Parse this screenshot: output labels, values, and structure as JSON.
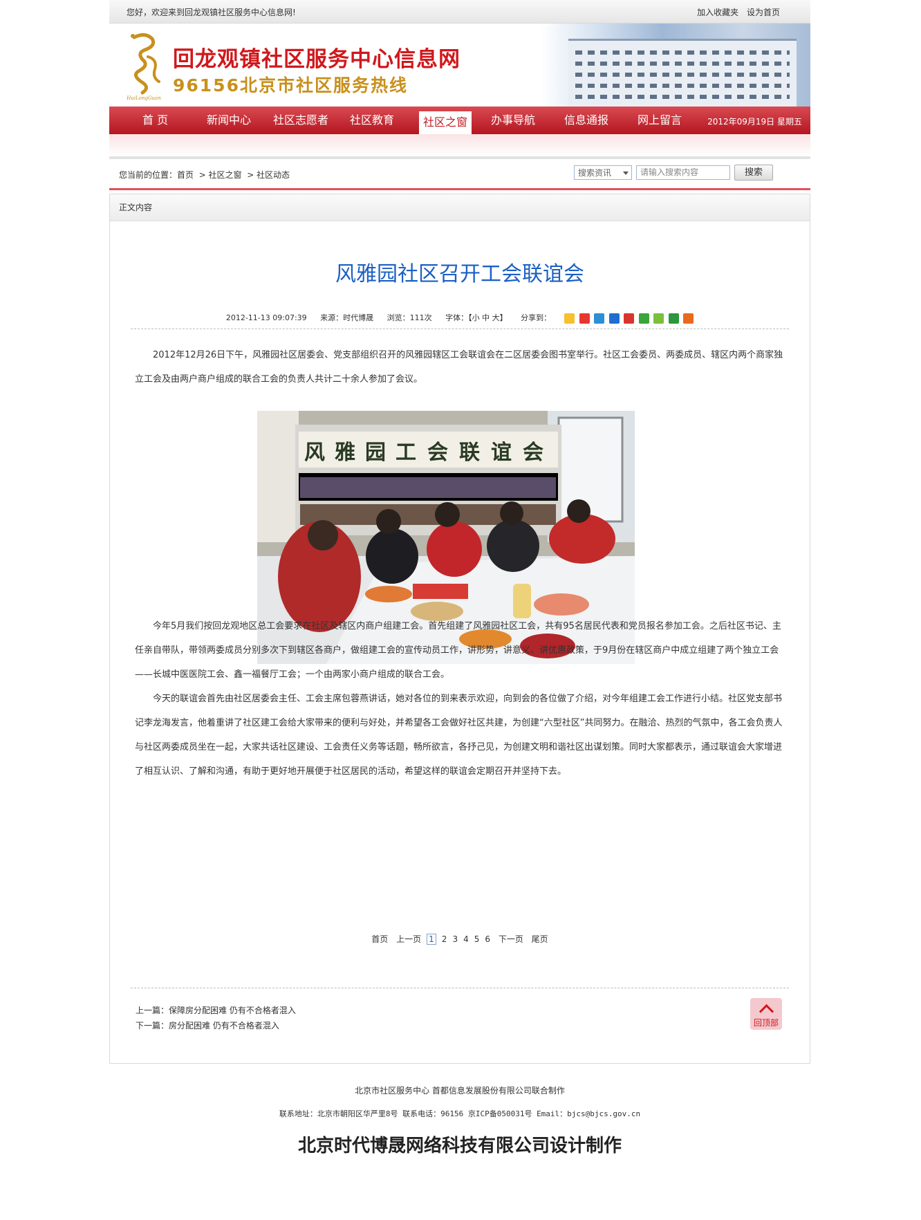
{
  "topbar": {
    "welcome": "您好，欢迎来到回龙观镇社区服务中心信息网!",
    "bookmark": "加入收藏夹",
    "homepage": "设为首页"
  },
  "banner": {
    "logo_text": "HuiLongGuan",
    "title": "回龙观镇社区服务中心信息网",
    "hotline": "96156北京市社区服务热线"
  },
  "nav": {
    "items": [
      "首 页",
      "新闻中心",
      "社区志愿者",
      "社区教育",
      "社区之窗",
      "办事导航",
      "信息通报",
      "网上留言"
    ],
    "active_index": 4,
    "date": "2012年09月19日 星期五"
  },
  "breadcrumb": {
    "prefix": "您当前的位置：",
    "items": [
      "首页",
      "社区之窗",
      "社区动态"
    ]
  },
  "search": {
    "select_value": "搜索资讯",
    "placeholder": "请输入搜索内容",
    "button": "搜索"
  },
  "content_header": "正文内容",
  "article": {
    "title": "风雅园社区召开工会联谊会",
    "datetime": "2012-11-13 09:07:39",
    "source": "来源：时代博晟",
    "views": "浏览：111次",
    "font_size": "字体：【小 中 大】",
    "share": "分享到：",
    "paragraphs": [
      "2012年12月26日下午，风雅园社区居委会、党支部组织召开的风雅园辖区工会联谊会在二区居委会图书室举行。社区工会委员、两委成员、辖区内两个商家独立工会及由两户商户组成的联合工会的负责人共计二十余人参加了会议。",
      "今年5月我们按回龙观地区总工会要求在社区及辖区内商户组建工会。首先组建了风雅园社区工会，共有95名居民代表和党员报名参加工会。之后社区书记、主任亲自带队，带领两委成员分别多次下到辖区各商户，做组建工会的宣传动员工作，讲形势，讲意义、讲优惠政策，于9月份在辖区商户中成立组建了两个独立工会——长城中医医院工会、鑫一福餐厅工会；一个由两家小商户组成的联合工会。",
      "今天的联谊会首先由社区居委会主任、工会主席包蓉燕讲话，她对各位的到来表示欢迎，向到会的各位做了介绍，对今年组建工会工作进行小结。社区党支部书记李龙海发言，他着重讲了社区建工会给大家带来的便利与好处，并希望各工会做好社区共建，为创建“六型社区”共同努力。在融洽、热烈的气氛中，各工会负责人与社区两委成员坐在一起，大家共话社区建设、工会责任义务等话题，畅所欲言，各抒己见，为创建文明和谐社区出谋划策。同时大家都表示，通过联谊会大家增进了相互认识、了解和沟通，有助于更好地开展便于社区居民的活动，希望这样的联谊会定期召开并坚持下去。"
    ],
    "photo_banner_chars": [
      "风",
      "雅",
      "园",
      "工",
      "会",
      "联",
      "谊",
      "会"
    ]
  },
  "pagination": {
    "first": "首页",
    "prev": "上一页",
    "pages": [
      "1",
      "2",
      "3",
      "4",
      "5",
      "6"
    ],
    "current": "1",
    "next": "下一页",
    "last": "尾页"
  },
  "prevnext": {
    "prev": "上一篇：保障房分配困难  仍有不合格者混入",
    "next": "下一篇：房分配困难  仍有不合格者混入"
  },
  "backtop": "回顶部",
  "footer": {
    "line1": "北京市社区服务中心  首都信息发展股份有限公司联合制作",
    "line2": "联系地址：北京市朝阳区华严里8号  联系电话：96156  京ICP备050031号  Email：bjcs@bjcs.gov.cn",
    "designer": "北京时代博晟网络科技有限公司设计制作"
  },
  "colors": {
    "nav_red": "#c4181f",
    "title_blue": "#1b5fc3",
    "hotline_gold": "#c8901c"
  },
  "share_icons": [
    "qzone-icon",
    "weibo-icon",
    "tencent-weibo-icon",
    "renren-icon",
    "kaixin-icon",
    "baidu-icon",
    "sohu-icon",
    "douban-icon",
    "more-icon"
  ]
}
